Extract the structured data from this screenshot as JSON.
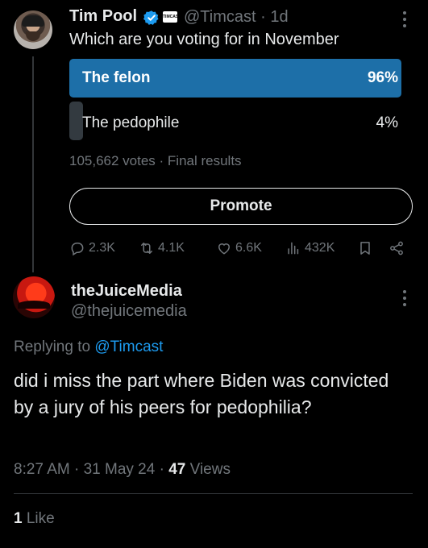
{
  "original_tweet": {
    "author_name": "Tim Pool",
    "brand_badge_text": "TIMCAST",
    "handle_time": "@Timcast · 1d",
    "text": "Which are you voting for in November",
    "poll": {
      "options": [
        {
          "label": "The felon",
          "percent": "96%",
          "fraction": 0.96
        },
        {
          "label": "The pedophile",
          "percent": "4%",
          "fraction": 0.04
        }
      ],
      "footer": "105,662 votes · Final results"
    },
    "promote_label": "Promote",
    "actions": {
      "replies": "2.3K",
      "reposts": "4.1K",
      "likes": "6.6K",
      "views": "432K"
    }
  },
  "reply": {
    "author_name": "theJuiceMedia",
    "handle": "@thejuicemedia",
    "replying_prefix": "Replying to ",
    "replying_mention": "@Timcast",
    "text": "did i miss the part where Biden was convicted by a jury of his peers for pedophilia?",
    "time_date": "8:27 AM · 31 May 24 · ",
    "views_count": "47",
    "views_label": " Views",
    "likes_count": "1",
    "likes_label": " Like"
  },
  "colors": {
    "background": "#000000",
    "text": "#e7e9ea",
    "muted": "#71767b",
    "accent": "#1d9bf0",
    "poll_winner": "#1d6fa8"
  },
  "icons": [
    "verified-icon",
    "more-icon",
    "reply-icon",
    "repost-icon",
    "like-icon",
    "views-icon",
    "bookmark-icon",
    "share-icon"
  ]
}
